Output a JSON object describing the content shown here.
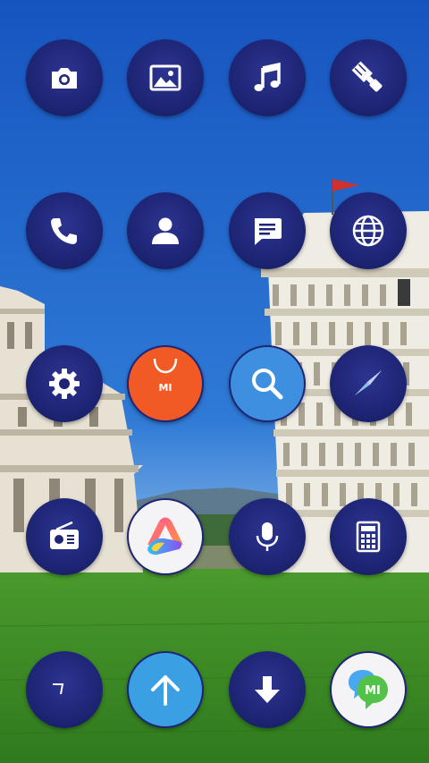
{
  "wallpaper": {
    "name": "pisa-wallpaper",
    "sky": "#1f66c9",
    "grass": "#3d8a28",
    "tower": "#ece8dc"
  },
  "accent": "#1e2575",
  "apps": [
    {
      "id": "camera",
      "icon": "camera-icon"
    },
    {
      "id": "gallery",
      "icon": "image-icon"
    },
    {
      "id": "music",
      "icon": "music-note-icon"
    },
    {
      "id": "themes",
      "icon": "paintbrush-icon"
    },
    {
      "id": "phone",
      "icon": "phone-icon"
    },
    {
      "id": "contacts",
      "icon": "person-icon"
    },
    {
      "id": "messages",
      "icon": "chat-bubble-icon"
    },
    {
      "id": "browser",
      "icon": "globe-icon"
    },
    {
      "id": "settings",
      "icon": "gear-icon"
    },
    {
      "id": "mi-store",
      "icon": "shopping-bag-icon",
      "label": "MI"
    },
    {
      "id": "search",
      "icon": "magnifier-icon"
    },
    {
      "id": "compass",
      "icon": "compass-icon"
    },
    {
      "id": "radio",
      "icon": "radio-icon"
    },
    {
      "id": "launcher-a",
      "icon": "rainbow-a-icon"
    },
    {
      "id": "recorder",
      "icon": "microphone-icon"
    },
    {
      "id": "calculator",
      "icon": "calculator-icon"
    },
    {
      "id": "clock",
      "icon": "clock-hand-icon"
    },
    {
      "id": "updater",
      "icon": "arrow-up-icon"
    },
    {
      "id": "downloads",
      "icon": "arrow-down-icon"
    },
    {
      "id": "mi-talk",
      "icon": "mi-chat-icon",
      "label": "MI"
    }
  ]
}
